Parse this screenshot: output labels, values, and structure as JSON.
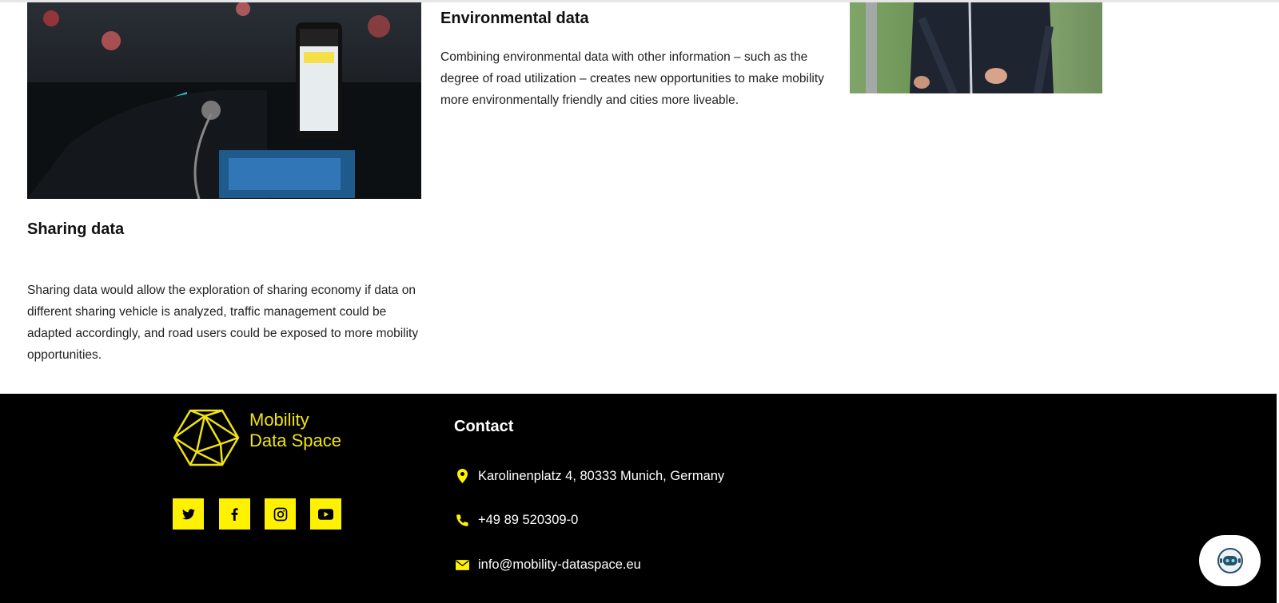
{
  "environmental": {
    "title": "Environmental data",
    "text": "Combining environmental data with other information – such as the degree of road utilization – creates new opportunities to make mobility more environmentally friendly and cities more liveable."
  },
  "sharing": {
    "title": "Sharing data",
    "text": "Sharing data would allow the exploration of sharing economy if data on different sharing vehicle is analyzed, traffic management could be adapted accordingly, and road users could be exposed to more mobility opportunities."
  },
  "footer": {
    "logo_line1": "Mobility",
    "logo_line2": "Data Space",
    "contact_title": "Contact",
    "address": "Karolinenplatz 4, 80333 Munich, Germany",
    "phone": "+49 89 520309-0",
    "email": "info@mobility-dataspace.eu",
    "social": [
      "twitter",
      "facebook",
      "instagram",
      "youtube"
    ]
  },
  "colors": {
    "accent": "#fff200",
    "footer_bg": "#000000"
  },
  "icons": {
    "address": "map-pin-icon",
    "phone": "phone-icon",
    "email": "envelope-icon",
    "chat": "chatbot-icon"
  }
}
